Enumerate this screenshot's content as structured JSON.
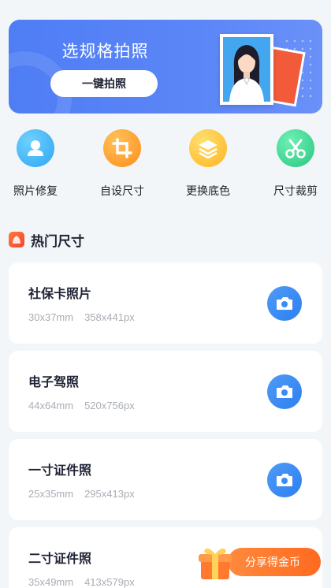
{
  "banner": {
    "title": "选规格拍照",
    "button_label": "一键拍照"
  },
  "tools": [
    {
      "label": "照片修复",
      "icon": "person-icon",
      "color": "#39b2f4"
    },
    {
      "label": "自设尺寸",
      "icon": "crop-icon",
      "color": "#ff9a22"
    },
    {
      "label": "更换底色",
      "icon": "layers-icon",
      "color": "#ffc42e"
    },
    {
      "label": "尺寸裁剪",
      "icon": "scissors-icon",
      "color": "#3bd493"
    }
  ],
  "section": {
    "title": "热门尺寸"
  },
  "sizes": [
    {
      "name": "社保卡照片",
      "mm": "30x37mm",
      "px": "358x441px"
    },
    {
      "name": "电子驾照",
      "mm": "44x64mm",
      "px": "520x756px"
    },
    {
      "name": "一寸证件照",
      "mm": "25x35mm",
      "px": "295x413px"
    },
    {
      "name": "二寸证件照",
      "mm": "35x49mm",
      "px": "413x579px"
    }
  ],
  "share": {
    "label": "分享得金币"
  }
}
